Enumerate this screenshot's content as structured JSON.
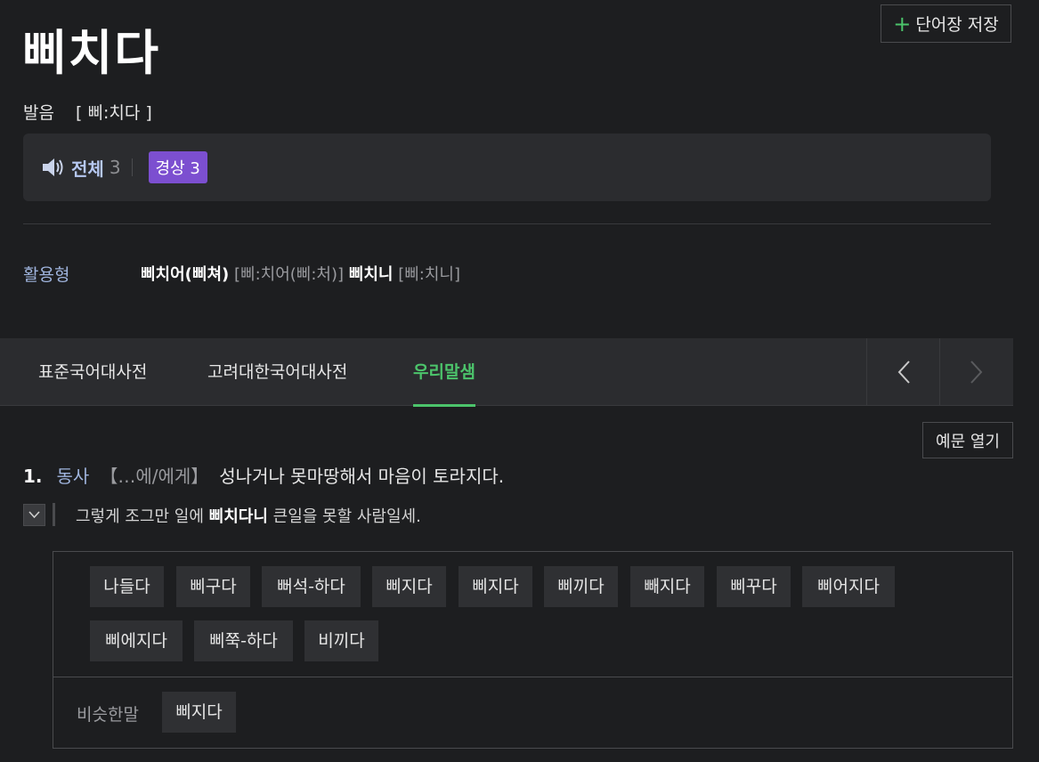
{
  "entry": {
    "headword": "삐치다",
    "save_button": "단어장 저장",
    "pronunciation_label": "발음",
    "pronunciation_value": "[ 삐:치다 ]"
  },
  "audio": {
    "all_label": "전체",
    "all_count": "3",
    "region_label": "경상 3"
  },
  "conjugation": {
    "label": "활용형",
    "form1": "삐치어(삐쳐)",
    "pron1": "[삐:치어(삐:처)]",
    "form2": "삐치니",
    "pron2": "[삐:치니]"
  },
  "tabs": [
    {
      "label": "표준국어대사전",
      "active": false
    },
    {
      "label": "고려대한국어대사전",
      "active": false
    },
    {
      "label": "우리말샘",
      "active": true
    }
  ],
  "open_examples_button": "예문 열기",
  "definition": {
    "number": "1.",
    "pos": "동사",
    "pattern": "【…에/에게】",
    "text": "성나거나 못마땅해서 마음이 토라지다."
  },
  "example": {
    "before": "그렇게 조그만 일에 ",
    "highlight": "삐치다니",
    "after": " 큰일을 못할 사람일세."
  },
  "related_words": [
    "나들다",
    "삐구다",
    "뻐석-하다",
    "삐지다",
    "삐지다",
    "삐끼다",
    "빼지다",
    "삐꾸다",
    "삐어지다",
    "삐에지다",
    "삐쭉-하다",
    "비끼다"
  ],
  "synonym": {
    "label": "비슷한말",
    "word": "삐지다"
  },
  "colors": {
    "background": "#1d1e20",
    "panel": "#2b2c2f",
    "accent_green": "#4cc46b",
    "region_badge": "#7c4fd0",
    "label_blue": "#9fb4dd"
  },
  "icons": {
    "save": "plus-icon",
    "audio": "speaker-icon",
    "prev": "chevron-left-icon",
    "next": "chevron-right-icon",
    "example_toggle": "chevron-down-icon"
  }
}
